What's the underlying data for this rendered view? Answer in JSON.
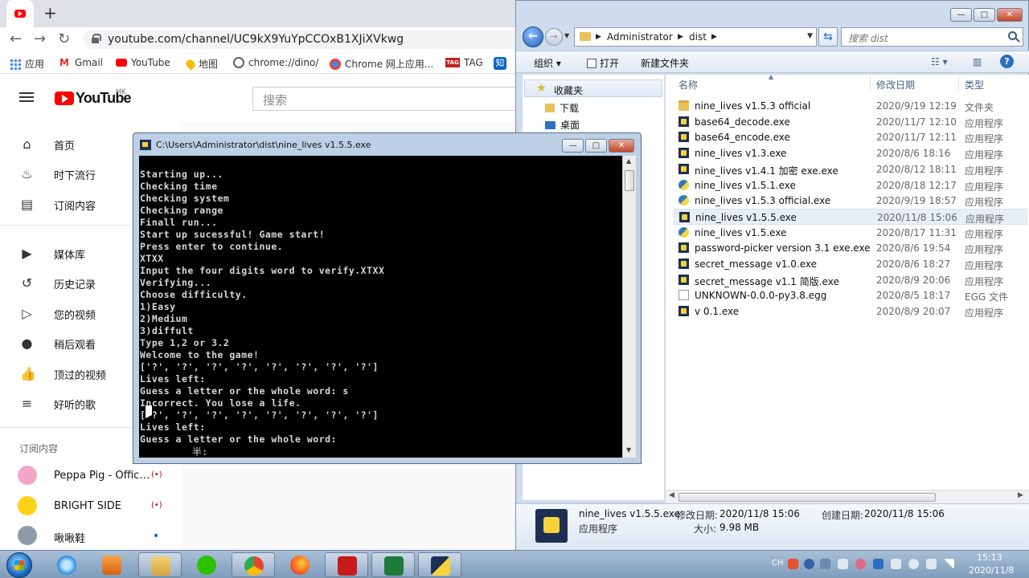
{
  "chrome": {
    "tab_icon": "youtube-icon",
    "new_tab": "+",
    "url": "youtube.com/channel/UC9kX9YuYpCCOxB1XJiXVkwg",
    "bookmarks": [
      "应用",
      "Gmail",
      "YouTube",
      "地图",
      "chrome://dino/",
      "Chrome 网上应用...",
      "TAG",
      "知"
    ]
  },
  "youtube": {
    "logo": "YouTube",
    "region": "HK",
    "search_placeholder": "搜索",
    "nav": [
      "首页",
      "时下流行",
      "订阅内容",
      "媒体库",
      "历史记录",
      "您的视频",
      "稍后观看",
      "顶过的视频",
      "好听的歌"
    ],
    "subscriptions_heading": "订阅内容",
    "subscriptions": [
      "Peppa Pig - Official...",
      "BRIGHT SIDE",
      "啾啾鞋"
    ]
  },
  "console": {
    "title": "C:\\Users\\Administrator\\dist\\nine_lives v1.5.5.exe",
    "lines": [
      "Starting up...",
      "Checking time",
      "Checking system",
      "Checking range",
      "Finall run...",
      "Start up sucessful! Game start!",
      "Press enter to continue.",
      "XTXX",
      "Input the four digits word to verify.XTXX",
      "Verifying...",
      "Choose difficulty.",
      "1)Easy",
      "2)Medium",
      "3)diffult",
      "Type 1,2 or 3.2",
      "Welcome to the game!",
      "['?', '?', '?', '?', '?', '?', '?', '?']",
      "Lives left:",
      "Guess a letter or the whole word: s",
      "Incorrect. You lose a life.",
      "['?', '?', '?', '?', '?', '?', '?', '?']",
      "Lives left:",
      "Guess a letter or the whole word:"
    ],
    "ime": "半:"
  },
  "explorer": {
    "breadcrumb": [
      "Administrator",
      "dist"
    ],
    "search_placeholder": "搜索 dist",
    "commands": {
      "organize": "组织",
      "open": "打开",
      "new_folder": "新建文件夹"
    },
    "nav": {
      "favorites": "收藏夹",
      "downloads": "下载",
      "desktop": "桌面"
    },
    "columns": {
      "name": "名称",
      "date": "修改日期",
      "type": "类型"
    },
    "files": [
      {
        "name": "nine_lives v1.5.3 official",
        "date": "2020/9/19 12:19",
        "type": "文件夹",
        "icon": "folder"
      },
      {
        "name": "base64_decode.exe",
        "date": "2020/11/7 12:10",
        "type": "应用程序",
        "icon": "exe"
      },
      {
        "name": "base64_encode.exe",
        "date": "2020/11/7 12:11",
        "type": "应用程序",
        "icon": "exe"
      },
      {
        "name": "nine_lives v1.3.exe",
        "date": "2020/8/6 18:16",
        "type": "应用程序",
        "icon": "exe"
      },
      {
        "name": "nine_lives v1.4.1 加密 exe.exe",
        "date": "2020/8/12 18:11",
        "type": "应用程序",
        "icon": "exe"
      },
      {
        "name": "nine_lives v1.5.1.exe",
        "date": "2020/8/18 12:17",
        "type": "应用程序",
        "icon": "py"
      },
      {
        "name": "nine_lives v1.5.3 official.exe",
        "date": "2020/9/19 18:57",
        "type": "应用程序",
        "icon": "py"
      },
      {
        "name": "nine_lives v1.5.5.exe",
        "date": "2020/11/8 15:06",
        "type": "应用程序",
        "icon": "exe",
        "selected": true
      },
      {
        "name": "nine_lives v1.5.exe",
        "date": "2020/8/17 11:31",
        "type": "应用程序",
        "icon": "py"
      },
      {
        "name": "password-picker version 3.1 exe.exe",
        "date": "2020/8/6 19:54",
        "type": "应用程序",
        "icon": "exe"
      },
      {
        "name": "secret_message v1.0.exe",
        "date": "2020/8/6 18:27",
        "type": "应用程序",
        "icon": "exe"
      },
      {
        "name": "secret_message v1.1 简版.exe",
        "date": "2020/8/9 20:06",
        "type": "应用程序",
        "icon": "exe"
      },
      {
        "name": "UNKNOWN-0.0.0-py3.8.egg",
        "date": "2020/8/5 18:17",
        "type": "EGG 文件",
        "icon": "egg"
      },
      {
        "name": "v 0.1.exe",
        "date": "2020/8/9 20:07",
        "type": "应用程序",
        "icon": "exe"
      }
    ],
    "details": {
      "name": "nine_lives v1.5.5.exe",
      "kind": "应用程序",
      "modified_label": "修改日期:",
      "modified": "2020/11/8 15:06",
      "created_label": "创建日期:",
      "created": "2020/11/8 15:06",
      "size_label": "大小:",
      "size": "9.98 MB"
    }
  },
  "taskbar": {
    "ime": "CH",
    "time": "15:13",
    "date": "2020/11/8"
  }
}
